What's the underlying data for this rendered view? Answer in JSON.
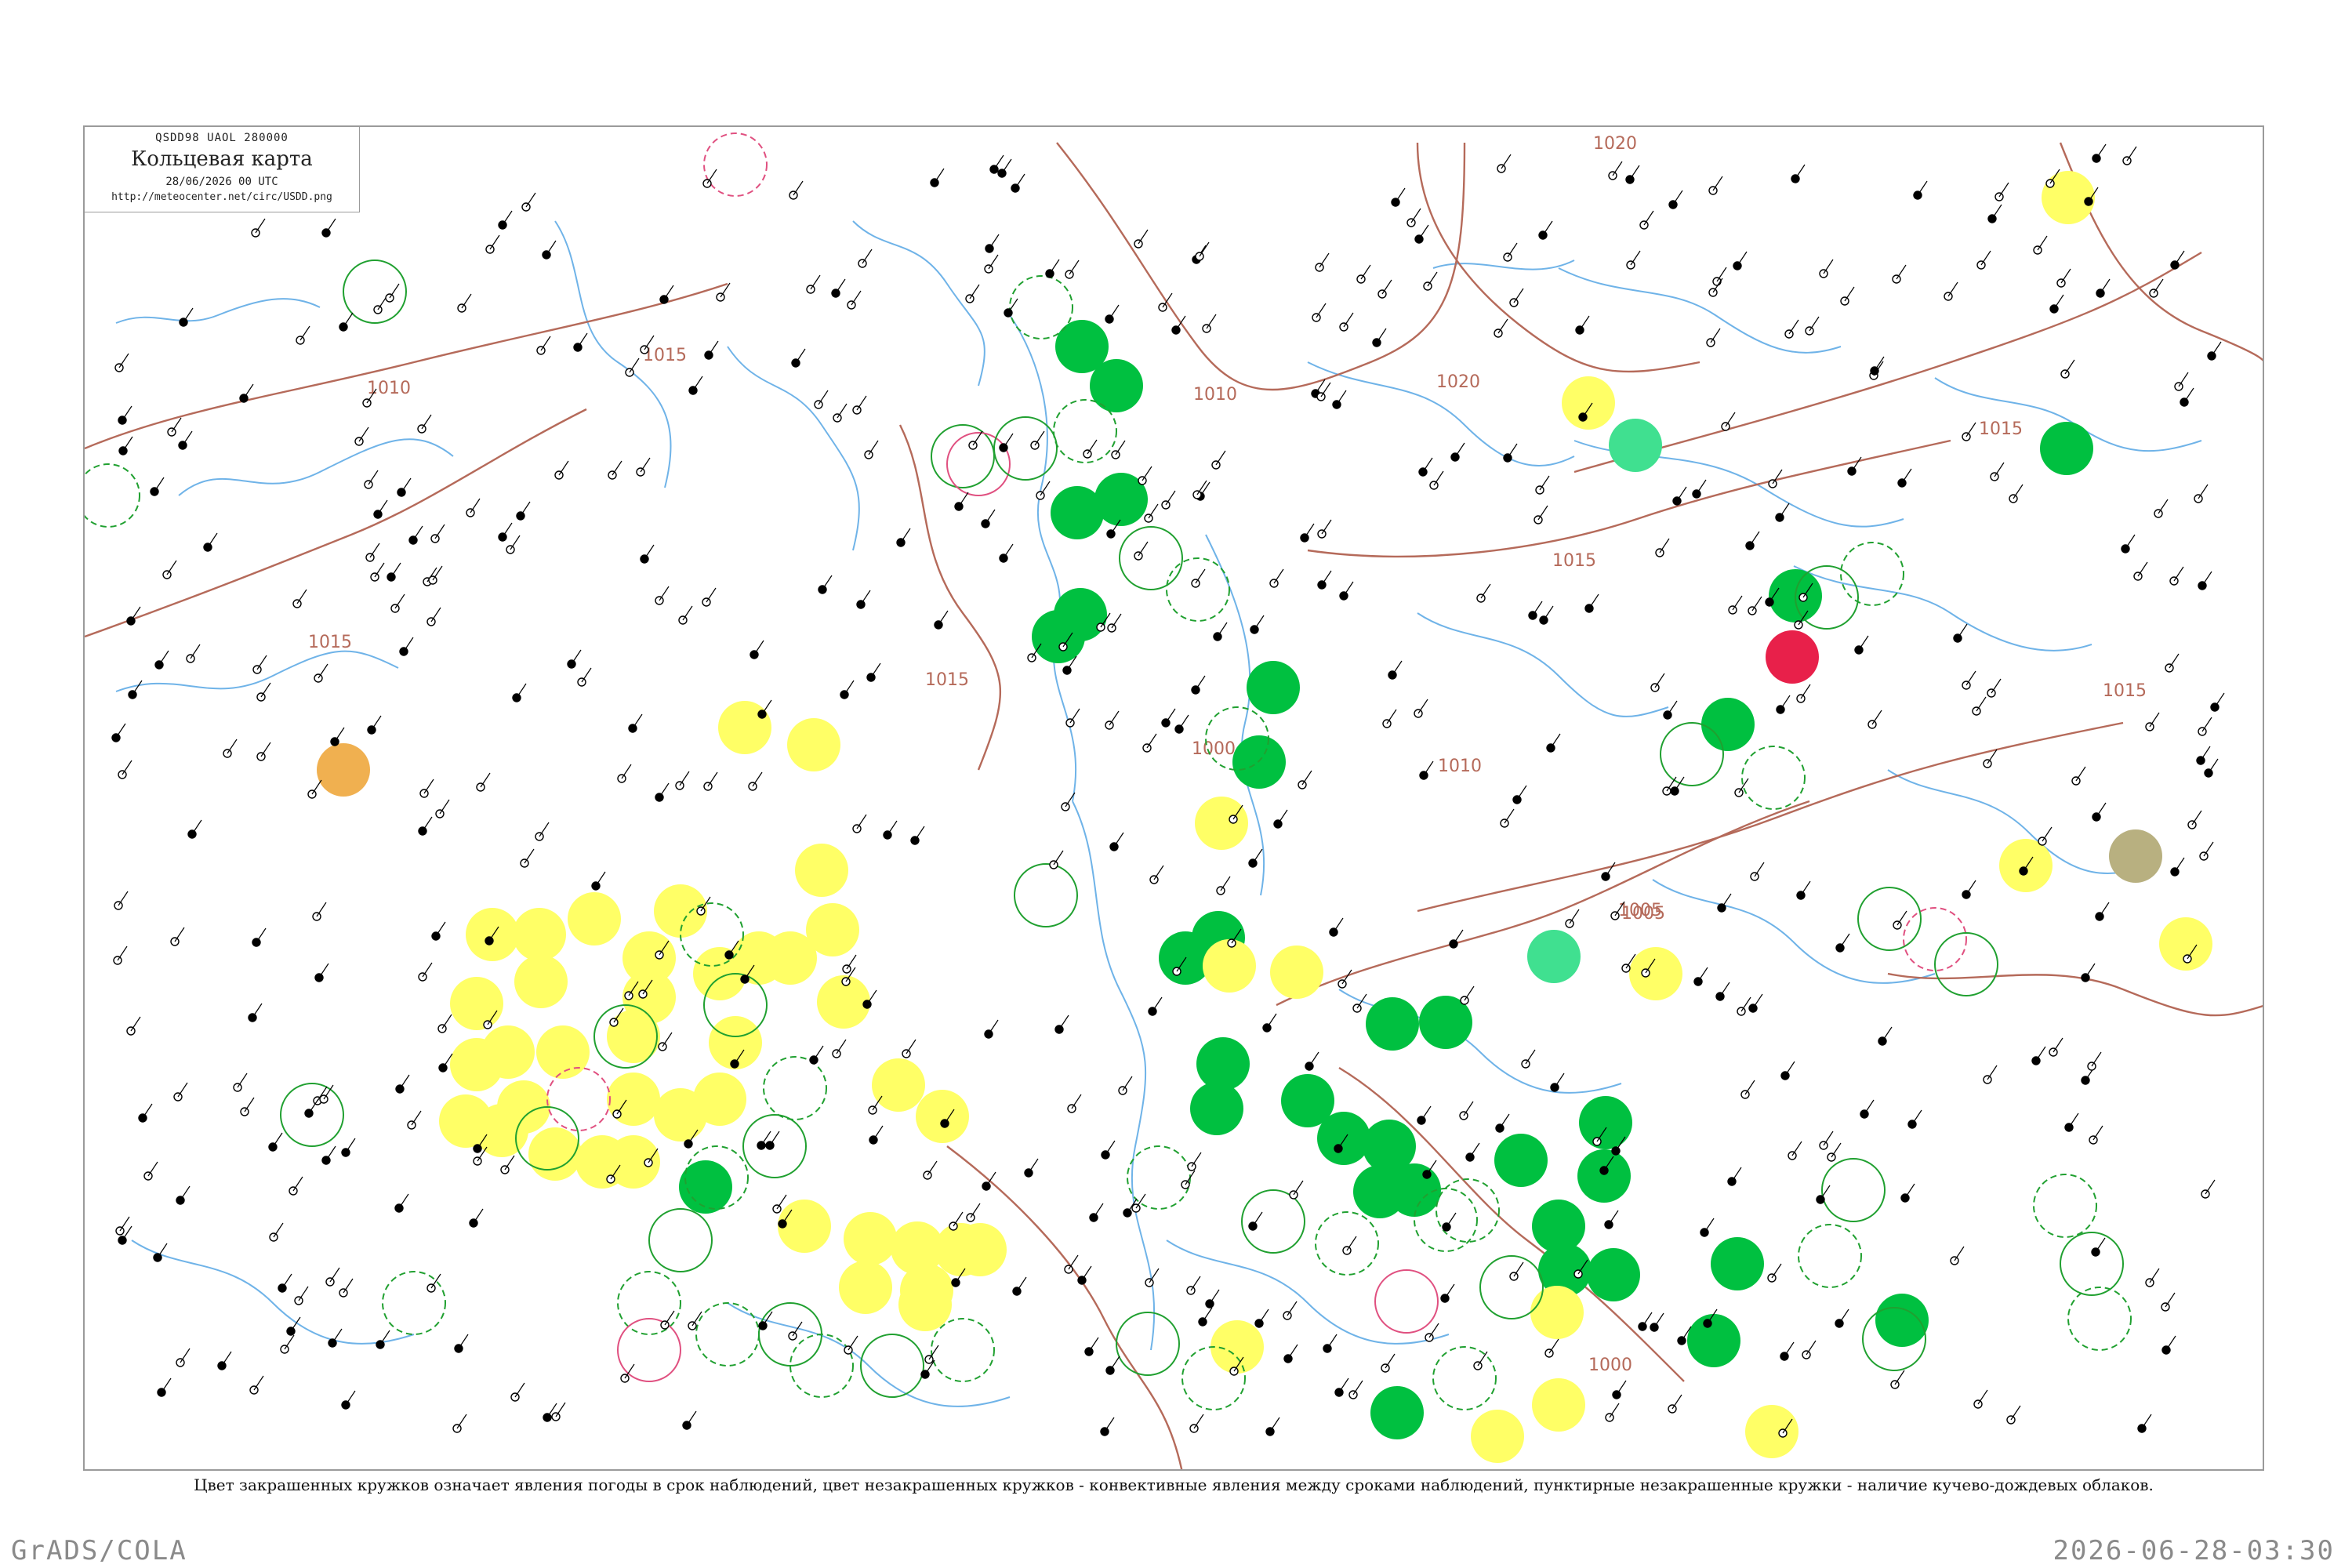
{
  "map": {
    "code_line": "QSDD98  UAOL  280000",
    "title": "Кольцевая карта",
    "datetime": "28/06/2026 00 UTC",
    "url": "http://meteocenter.net/circ/USDD.png"
  },
  "isobars": {
    "color": "#b56a5a",
    "labels": [
      "1010",
      "1015",
      "1015",
      "1015",
      "1010",
      "1010",
      "1020",
      "1020",
      "1015",
      "1015",
      "1005",
      "1005",
      "1000",
      "1000",
      "1015"
    ]
  },
  "legend": {
    "colors": {
      "precip_light": "#ffff66",
      "precip_moderate": "#00c040",
      "showers_orange": "#f0b050",
      "thunderstorm_red": "#e8204a",
      "mixed_teal": "#40e090",
      "haze_olive": "#b8b080",
      "convective_ring": "#20a030",
      "convective_ring_pink": "#e05080"
    },
    "caption": "Цвет закрашенных кружков означает явления погоды в срок наблюдений, цвет незакрашенных кружков - конвективные явления между сроками наблюдений, пунктирные незакрашенные кружки - наличие кучево-дождевых облаков."
  },
  "footer": {
    "left": "GrADS/COLA",
    "right": "2026-06-28-03:30"
  }
}
